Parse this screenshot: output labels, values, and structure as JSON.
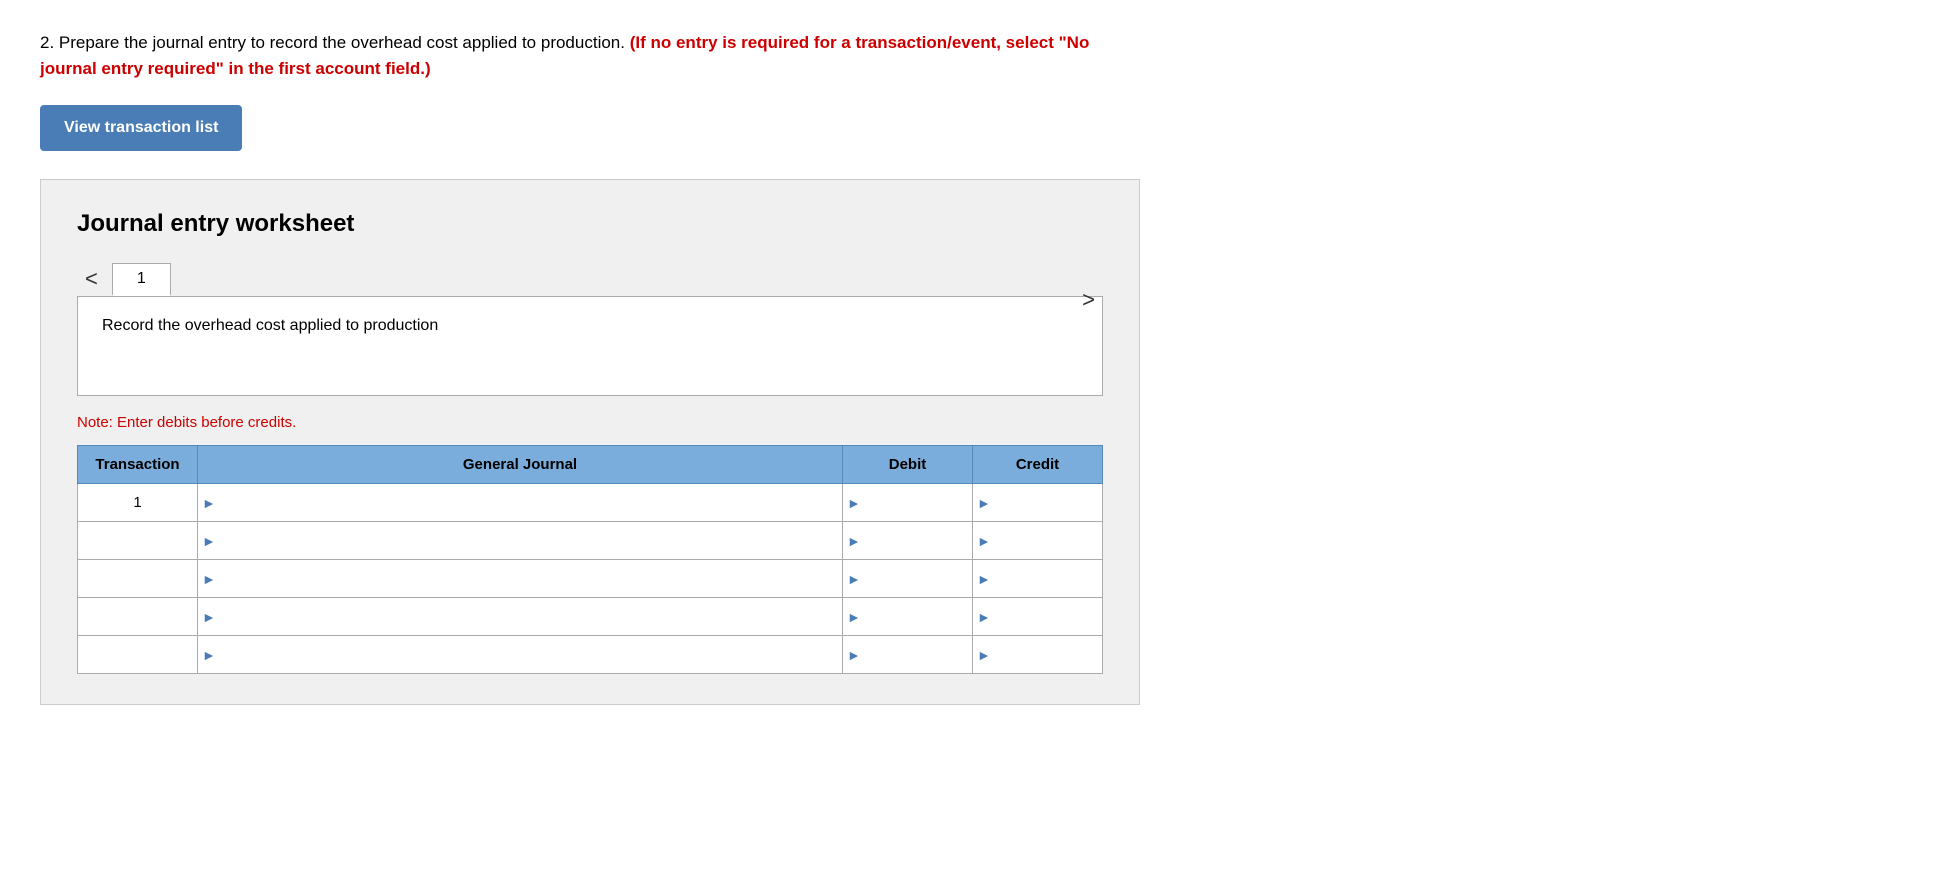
{
  "instruction": {
    "black_text": "2. Prepare the journal entry to record the overhead cost applied to production.",
    "red_text": "(If no entry is required for a transaction/event, select \"No journal entry required\" in the first account field.)"
  },
  "button": {
    "view_transaction_list": "View transaction list"
  },
  "worksheet": {
    "title": "Journal entry worksheet",
    "nav_left": "<",
    "nav_right": ">",
    "tab_number": "1",
    "description": "Record the overhead cost applied to production",
    "note": "Note: Enter debits before credits.",
    "table": {
      "headers": {
        "transaction": "Transaction",
        "general_journal": "General Journal",
        "debit": "Debit",
        "credit": "Credit"
      },
      "rows": [
        {
          "transaction": "1",
          "general_journal": "",
          "debit": "",
          "credit": ""
        },
        {
          "transaction": "",
          "general_journal": "",
          "debit": "",
          "credit": ""
        },
        {
          "transaction": "",
          "general_journal": "",
          "debit": "",
          "credit": ""
        },
        {
          "transaction": "",
          "general_journal": "",
          "debit": "",
          "credit": ""
        },
        {
          "transaction": "",
          "general_journal": "",
          "debit": "",
          "credit": ""
        }
      ]
    }
  }
}
